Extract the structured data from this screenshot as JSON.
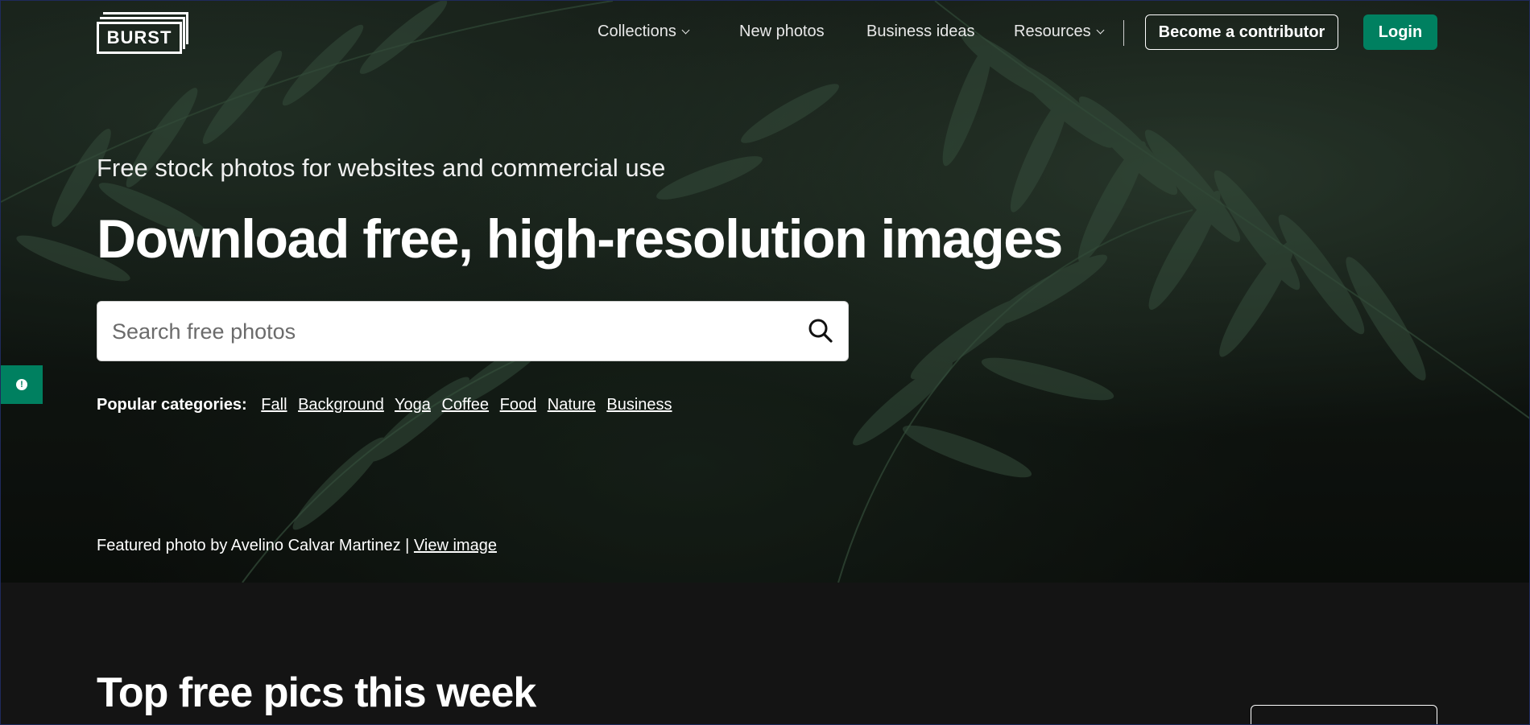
{
  "brand": {
    "logo_text": "BURST"
  },
  "nav": {
    "collections": "Collections",
    "new_photos": "New photos",
    "business_ideas": "Business ideas",
    "resources": "Resources",
    "become_contributor": "Become a contributor",
    "login": "Login"
  },
  "hero": {
    "subtitle": "Free stock photos for websites and commercial use",
    "headline": "Download free, high-resolution images",
    "search_placeholder": "Search free photos",
    "popular_label": "Popular categories:",
    "categories": [
      "Fall",
      "Background",
      "Yoga",
      "Coffee",
      "Food",
      "Nature",
      "Business"
    ],
    "featured_text": "Featured photo by Avelino Calvar Martinez |",
    "featured_link": "View image"
  },
  "section": {
    "title": "Top free pics this week"
  },
  "colors": {
    "brand_green": "#008060",
    "page_bg": "#141414"
  },
  "icons": {
    "search": "search-icon",
    "chevron": "chevron-down-icon",
    "feedback": "feedback-icon"
  }
}
